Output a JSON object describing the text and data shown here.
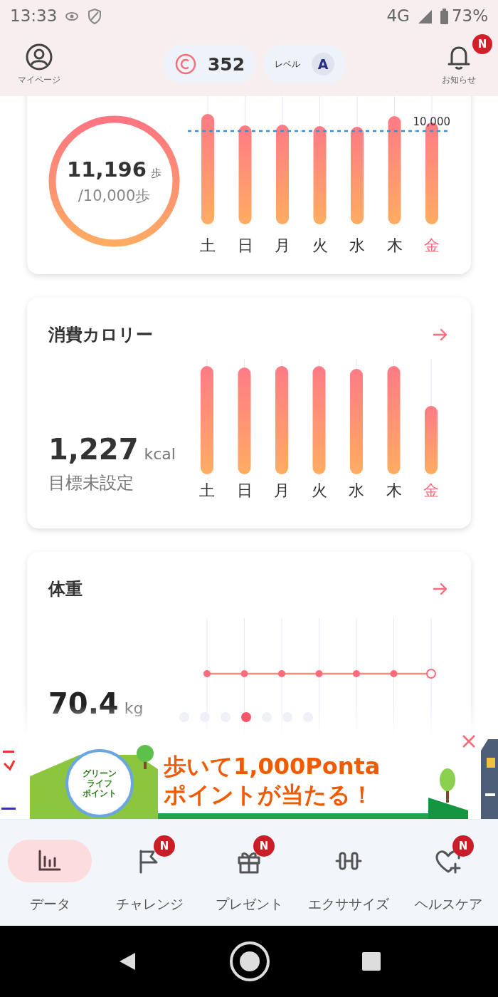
{
  "status_bar": {
    "time": "13:33",
    "network": "4G",
    "battery": "73%"
  },
  "header": {
    "mypage_label": "マイページ",
    "points": "352",
    "level_label": "レベル",
    "level": "A",
    "notice_badge": "N",
    "notice_label": "お知らせ"
  },
  "steps_card": {
    "ring": {
      "level": 1
    },
    "value": "11,196",
    "unit": "歩",
    "goal": "/10,000歩",
    "goal_line_label": "10,000",
    "days": [
      {
        "label": "土",
        "selected": false
      },
      {
        "label": "日",
        "selected": false
      },
      {
        "label": "月",
        "selected": false
      },
      {
        "label": "火",
        "selected": false
      },
      {
        "label": "水",
        "selected": false
      },
      {
        "label": "木",
        "selected": false
      },
      {
        "label": "金",
        "selected": true
      }
    ]
  },
  "calorie_card": {
    "title": "消費カロリー",
    "value": "1,227",
    "unit": "kcal",
    "goal": "目標未設定",
    "days": [
      {
        "label": "土",
        "selected": false
      },
      {
        "label": "日",
        "selected": false
      },
      {
        "label": "月",
        "selected": false
      },
      {
        "label": "火",
        "selected": false
      },
      {
        "label": "水",
        "selected": false
      },
      {
        "label": "木",
        "selected": false
      },
      {
        "label": "金",
        "selected": true
      }
    ]
  },
  "weight_card": {
    "title": "体重",
    "value": "70.4",
    "unit": "kg"
  },
  "carousel_dots": [
    {
      "selected": false
    },
    {
      "selected": false
    },
    {
      "selected": false
    },
    {
      "selected": true
    },
    {
      "selected": false
    },
    {
      "selected": false
    },
    {
      "selected": false
    }
  ],
  "banner": {
    "logo_lines": [
      "グリーン",
      "ライフ",
      "ポイント"
    ],
    "headline": "歩いて1,000Ponta",
    "subline": "ポイントが当たる！"
  },
  "nav": [
    {
      "kind": "chart",
      "label": "データ",
      "selected": true
    },
    {
      "kind": "flag",
      "label": "チャレンジ",
      "selected": false,
      "badge": "N"
    },
    {
      "kind": "gift",
      "label": "プレゼント",
      "selected": false,
      "badge": "N"
    },
    {
      "kind": "dumbbell",
      "label": "エクササイズ",
      "selected": false
    },
    {
      "kind": "heart",
      "label": "ヘルスケア",
      "selected": false,
      "badge": "N"
    }
  ]
}
